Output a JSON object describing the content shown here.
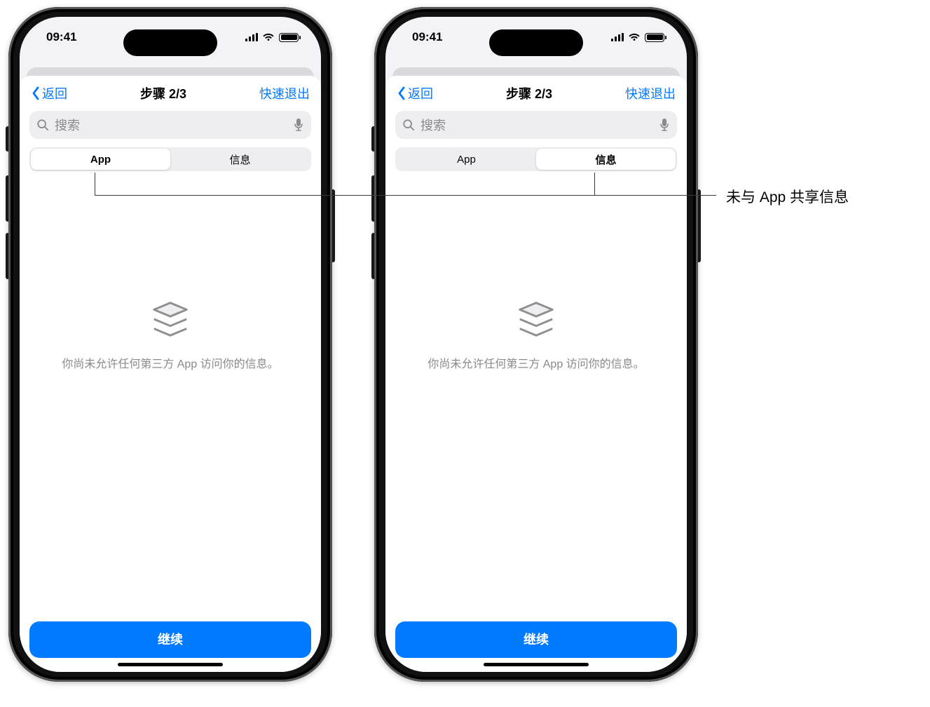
{
  "statusbar": {
    "time": "09:41"
  },
  "nav": {
    "back_label": "返回",
    "title": "步骤 2/3",
    "exit_label": "快速退出"
  },
  "search": {
    "placeholder": "搜索"
  },
  "segments": {
    "app": "App",
    "info": "信息"
  },
  "empty": {
    "message": "你尚未允许任何第三方 App 访问你的信息。"
  },
  "cta": {
    "label": "继续"
  },
  "callout": {
    "text": "未与 App 共享信息"
  },
  "accent": "#007aff"
}
